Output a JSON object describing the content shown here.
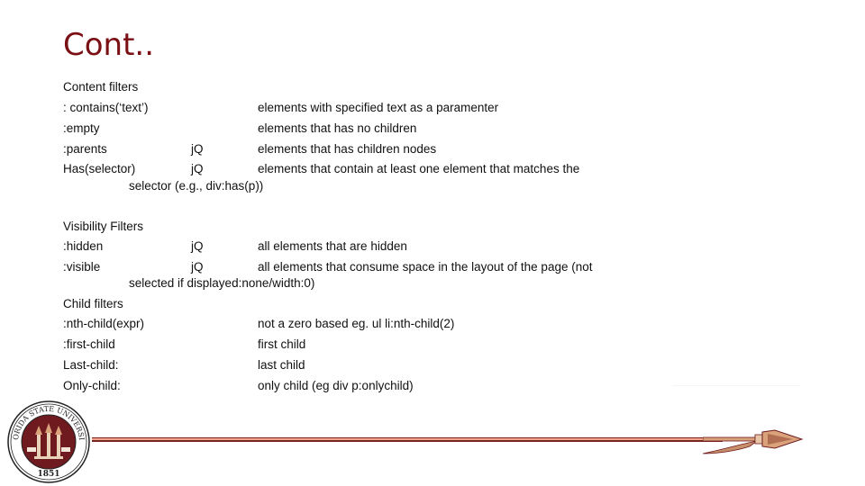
{
  "slide": {
    "title": "Cont..",
    "content_filters": {
      "heading": "Content filters",
      "rows": [
        {
          "selector": ": contains(‘text’)",
          "lib": "",
          "description": "elements with specified text as a paramenter"
        },
        {
          "selector": ":empty",
          "lib": "",
          "description": "elements that has no children"
        },
        {
          "selector": ":parents",
          "lib": "jQ",
          "description": "elements that has children nodes"
        },
        {
          "selector": "Has(selector)",
          "lib": "jQ",
          "description": "elements that contain at least one element that matches the"
        }
      ],
      "continuation": "selector (e.g., div:has(p))"
    },
    "visibility_filters": {
      "heading": "Visibility Filters",
      "rows": [
        {
          "selector": ":hidden",
          "lib": "jQ",
          "description": "all elements that are hidden"
        },
        {
          "selector": ":visible",
          "lib": "jQ",
          "description": "all elements that consume space in the layout of the page (not"
        }
      ],
      "continuation": "selected if displayed:none/width:0)"
    },
    "child_filters": {
      "heading": "Child filters",
      "rows": [
        {
          "selector": ":nth-child(expr)",
          "description": "not a zero based eg. ul li:nth-child(2)"
        },
        {
          "selector": ":first-child",
          "description": "first child"
        },
        {
          "selector": "Last-child:",
          "description": "last child"
        },
        {
          "selector": "Only-child:",
          "description": "only child (eg div p:onlychild)"
        }
      ]
    },
    "footer": {
      "logo_name": "Florida State University seal",
      "seal_text": "FLORIDA STATE UNIVERSITY",
      "seal_year": "1851",
      "colors": {
        "garnet": "#7a0f14",
        "gold": "#d9a27a",
        "rule_light": "#f0a58c"
      }
    }
  }
}
